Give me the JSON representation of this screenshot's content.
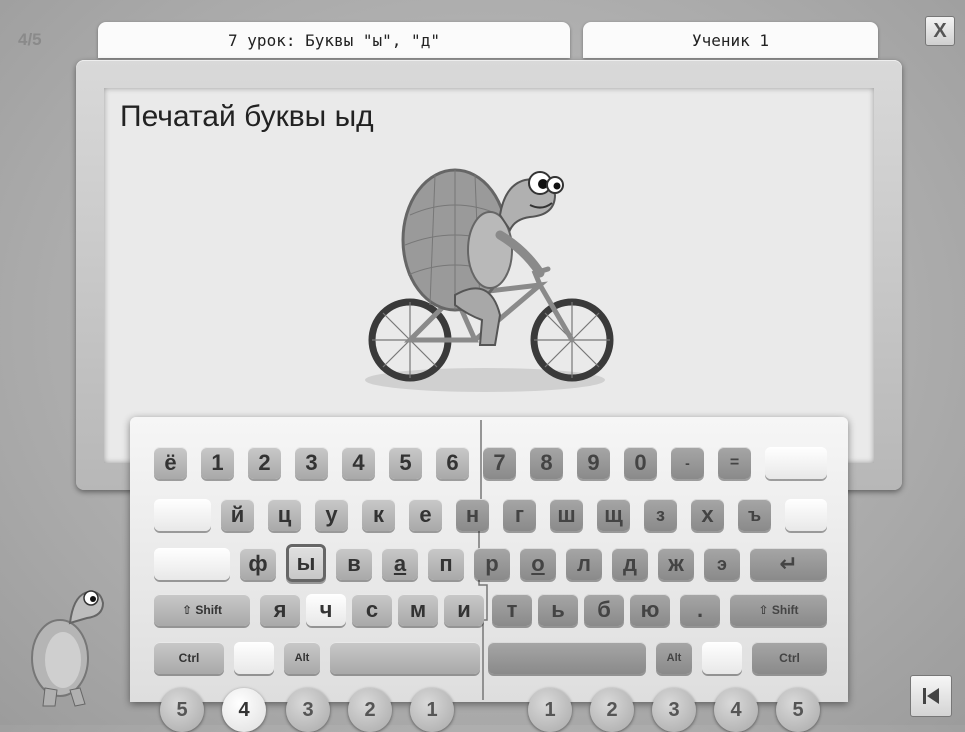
{
  "header": {
    "progress": "4/5",
    "lesson_title": "7 урок: Буквы \"ы\", \"д\"",
    "student": "Ученик 1",
    "close_label": "X"
  },
  "board": {
    "instruction": "Печатай буквы ыд"
  },
  "keyboard": {
    "row1": [
      "ё",
      "1",
      "2",
      "3",
      "4",
      "5",
      "6",
      "7",
      "8",
      "9",
      "0",
      "-",
      "=",
      ""
    ],
    "row2": [
      "",
      "й",
      "ц",
      "у",
      "к",
      "е",
      "н",
      "г",
      "ш",
      "щ",
      "з",
      "х",
      "ъ",
      ""
    ],
    "row3": [
      "",
      "ф",
      "ы",
      "в",
      "а",
      "п",
      "р",
      "о",
      "л",
      "д",
      "ж",
      "э",
      "↵"
    ],
    "row4": [
      "⇧ Shift",
      "я",
      "ч",
      "с",
      "м",
      "и",
      "т",
      "ь",
      "б",
      "ю",
      ".",
      "⇧ Shift"
    ],
    "row5": [
      "Ctrl",
      "",
      "Alt",
      "",
      "",
      "Alt",
      "",
      "Ctrl"
    ]
  },
  "fingers": {
    "left": [
      "5",
      "4",
      "3",
      "2",
      "1"
    ],
    "right": [
      "1",
      "2",
      "3",
      "4",
      "5"
    ],
    "active": "left-4"
  },
  "colors": {
    "background": "#a9a9a9",
    "board": "#eaeaea",
    "left_hand_keys": "#b9b9b9",
    "right_hand_keys": "#989898"
  },
  "icons": {
    "close": "close-icon",
    "back": "skip-back-icon",
    "mascot": "turtle-icon"
  }
}
